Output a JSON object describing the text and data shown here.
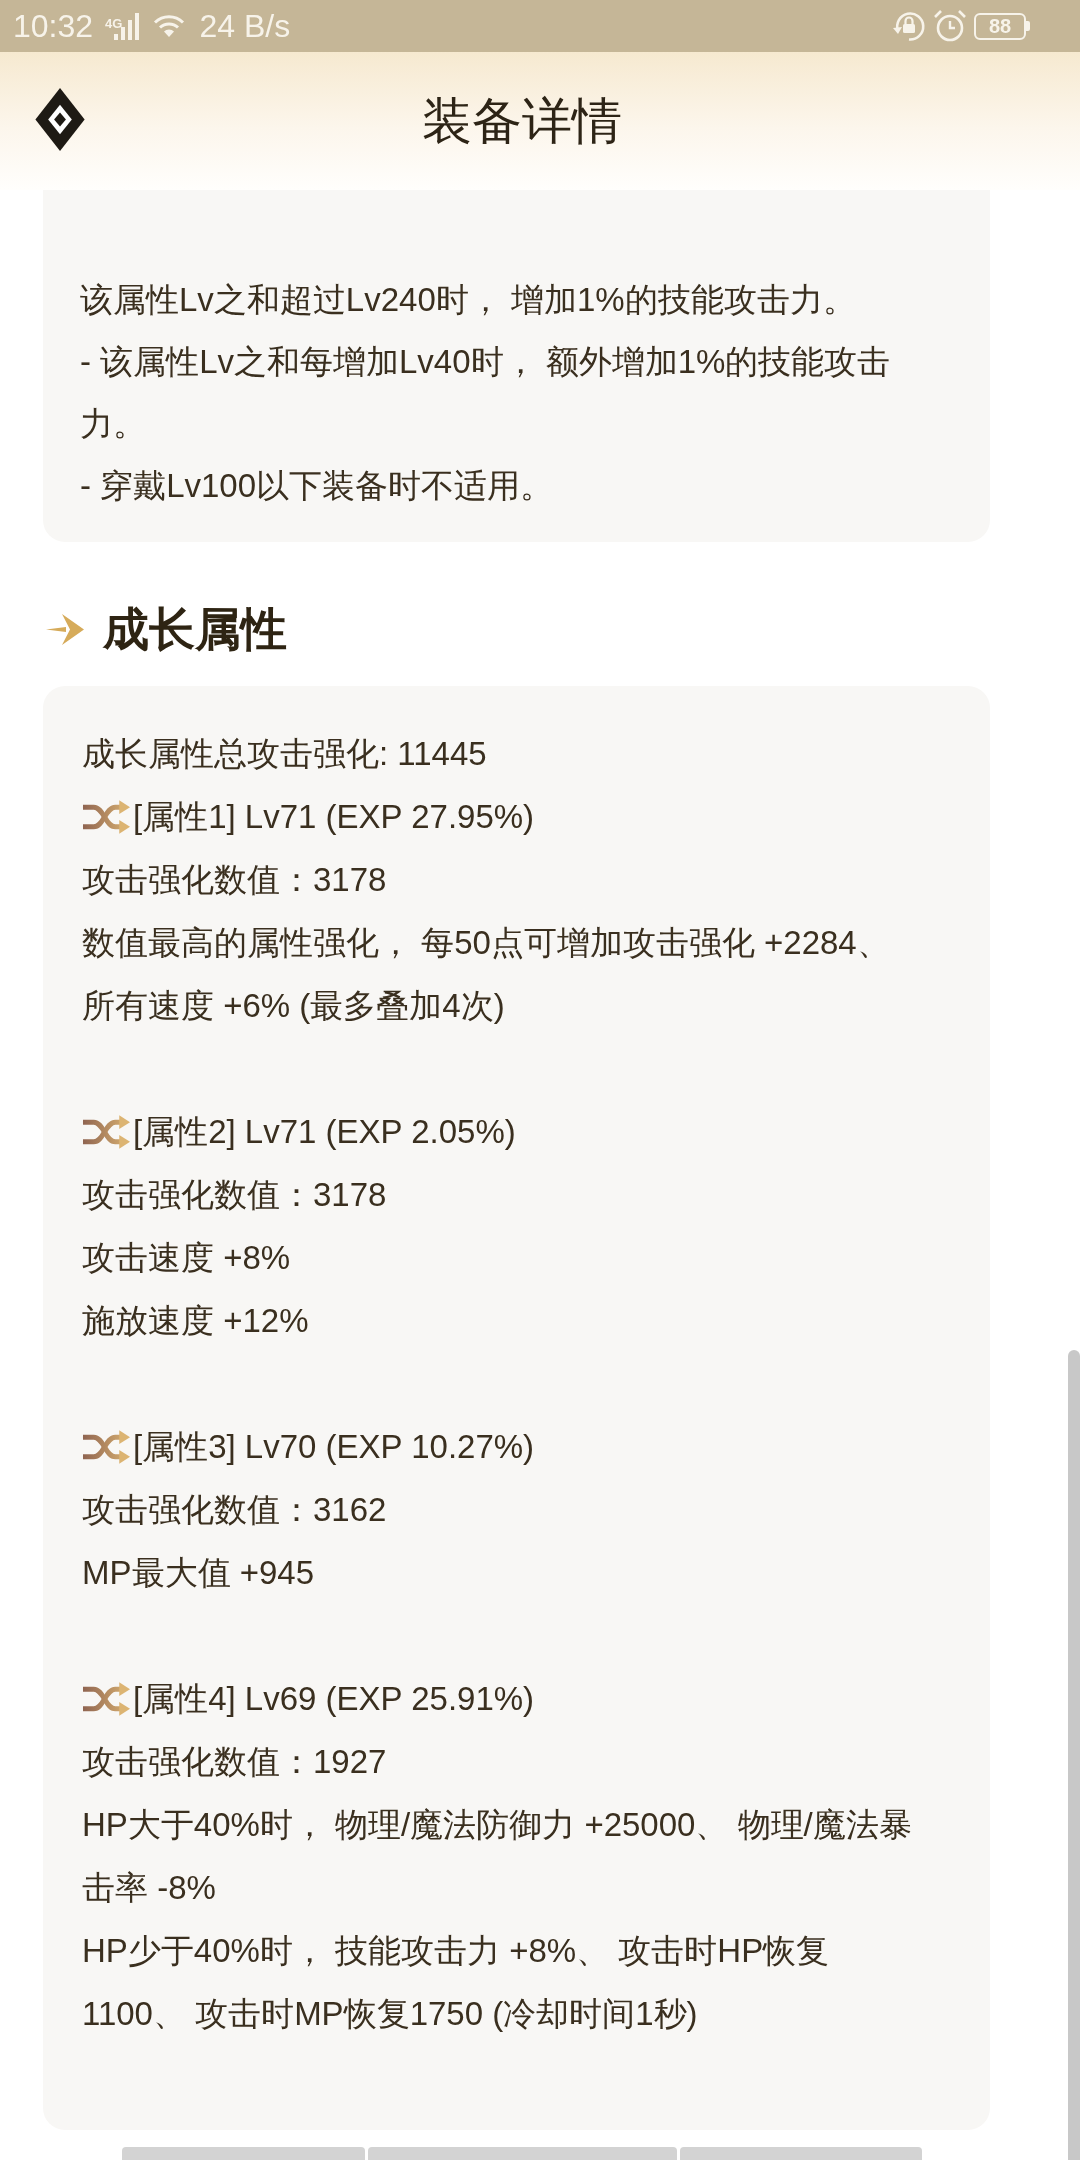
{
  "status_bar": {
    "time": "10:32",
    "network": "4G",
    "speed": "24 B/s",
    "battery": "88"
  },
  "header": {
    "title": "装备详情"
  },
  "description": {
    "paragraphs": [
      "该属性Lv之和超过Lv240时， 增加1%的技能攻击力。",
      "- 该属性Lv之和每增加Lv40时， 额外增加1%的技能攻击力。",
      "- 穿戴Lv100以下装备时不适用。"
    ]
  },
  "growth": {
    "title": "成长属性",
    "total": "成长属性总攻击强化: 11445",
    "attributes": [
      {
        "title": "[属性1] Lv71 (EXP 27.95%)",
        "lines": [
          "攻击强化数值：3178",
          "数值最高的属性强化， 每50点可增加攻击强化 +2284、",
          "所有速度 +6% (最多叠加4次)"
        ]
      },
      {
        "title": "[属性2] Lv71 (EXP 2.05%)",
        "lines": [
          "攻击强化数值：3178",
          "攻击速度 +8%",
          "施放速度 +12%"
        ]
      },
      {
        "title": "[属性3] Lv70 (EXP 10.27%)",
        "lines": [
          "攻击强化数值：3162",
          "MP最大值 +945"
        ]
      },
      {
        "title": "[属性4] Lv69 (EXP 25.91%)",
        "lines": [
          "攻击强化数值：1927",
          "HP大于40%时， 物理/魔法防御力 +25000、 物理/魔法暴击率 -8%",
          "HP少于40%时， 技能攻击力 +8%、 攻击时HP恢复1100、 攻击时MP恢复1750 (冷却时间1秒)"
        ]
      }
    ]
  }
}
